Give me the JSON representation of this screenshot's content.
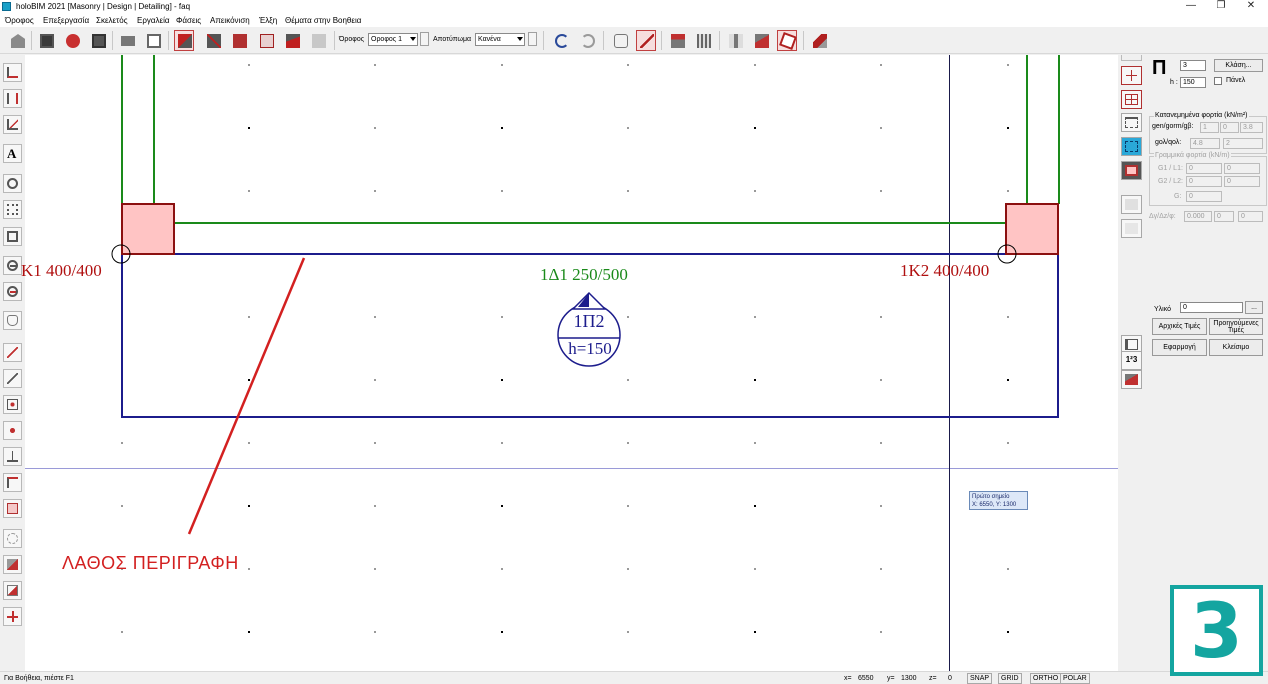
{
  "window": {
    "title": "holoBIM 2021 [Masonry | Design | Detailing] - faq",
    "minimize": "—",
    "restore": "❐",
    "close": "✕"
  },
  "menu": [
    "Όροφος",
    "Επεξεργασία",
    "Σκελετός",
    "Εργαλεία",
    "Φάσεις",
    "Απεικόνιση",
    "Έλξη",
    "Θέματα στην Βοηθεια"
  ],
  "toolbar": {
    "floor_label": "Όροφος",
    "floor_value": "Οροφος 1",
    "footprint_label": "Αποτύπωμα",
    "footprint_value": "Κανένα"
  },
  "drawing": {
    "column1_label": "Κ1  400/400",
    "column2_label": "1Κ2  400/400",
    "beam_label": "1Δ1  250/500",
    "slab_name": "1Π2",
    "slab_height": "h=150",
    "tooltip_line1": "Πρώτο σημείο",
    "tooltip_line2": "X: 6550, Y: 1300",
    "annotation": "ΛΑΘΟΣ ΠΕΡΙΓΡΑΦΗ"
  },
  "panel": {
    "slab_symbol": "Π",
    "number_value": "3",
    "class_button": "Κλάση...",
    "h_label": "h :",
    "h_value": "150",
    "panel_checkbox": "Πάνελ",
    "distributed_group": "Κατανεμημένα φορτία (kN/m²)",
    "gen_label": "gen/gorm/gβ:",
    "gen_values": [
      "1",
      "0",
      "3.8"
    ],
    "gol_label": "gολ/qολ:",
    "gol_values": [
      "4.8",
      "2"
    ],
    "line_group": "Γραμμικά φορτία (kN/m)",
    "g1l1_label": "G1 / L1:",
    "g1l1_values": [
      "0",
      "0"
    ],
    "g2l2_label": "G2 / L2:",
    "g2l2_values": [
      "0",
      "0"
    ],
    "g_label": "G:",
    "g_value": "0",
    "ay_label": "Δγ/Δz/φ:",
    "ay_values": [
      "0.000",
      "0",
      "0"
    ],
    "material_label": "Υλικό",
    "material_value": "0",
    "material_button": "...",
    "initial_button": "Αρχικές Τιμές",
    "previous_button": "Προηγούμενες Τιμές",
    "apply_button": "Εφαρμογή",
    "close_button": "Κλείσιμο"
  },
  "status": {
    "help": "Για Βοήθεια, πιέστε F1",
    "x_label": "x=",
    "x_value": "6550",
    "y_label": "y=",
    "y_value": "1300",
    "z_label": "z=",
    "z_value": "0",
    "snap": "SNAP",
    "grid": "GRID",
    "ortho": "ORTHO",
    "polar": "POLAR"
  },
  "badge": "3",
  "colors": {
    "column_fill": "#ffc4c4",
    "column_stroke": "#8b1010",
    "beam_green": "#1a8a1a",
    "slab_blue": "#1c1c8c",
    "annotation_red": "#d32020",
    "badge_teal": "#14a5a0"
  }
}
